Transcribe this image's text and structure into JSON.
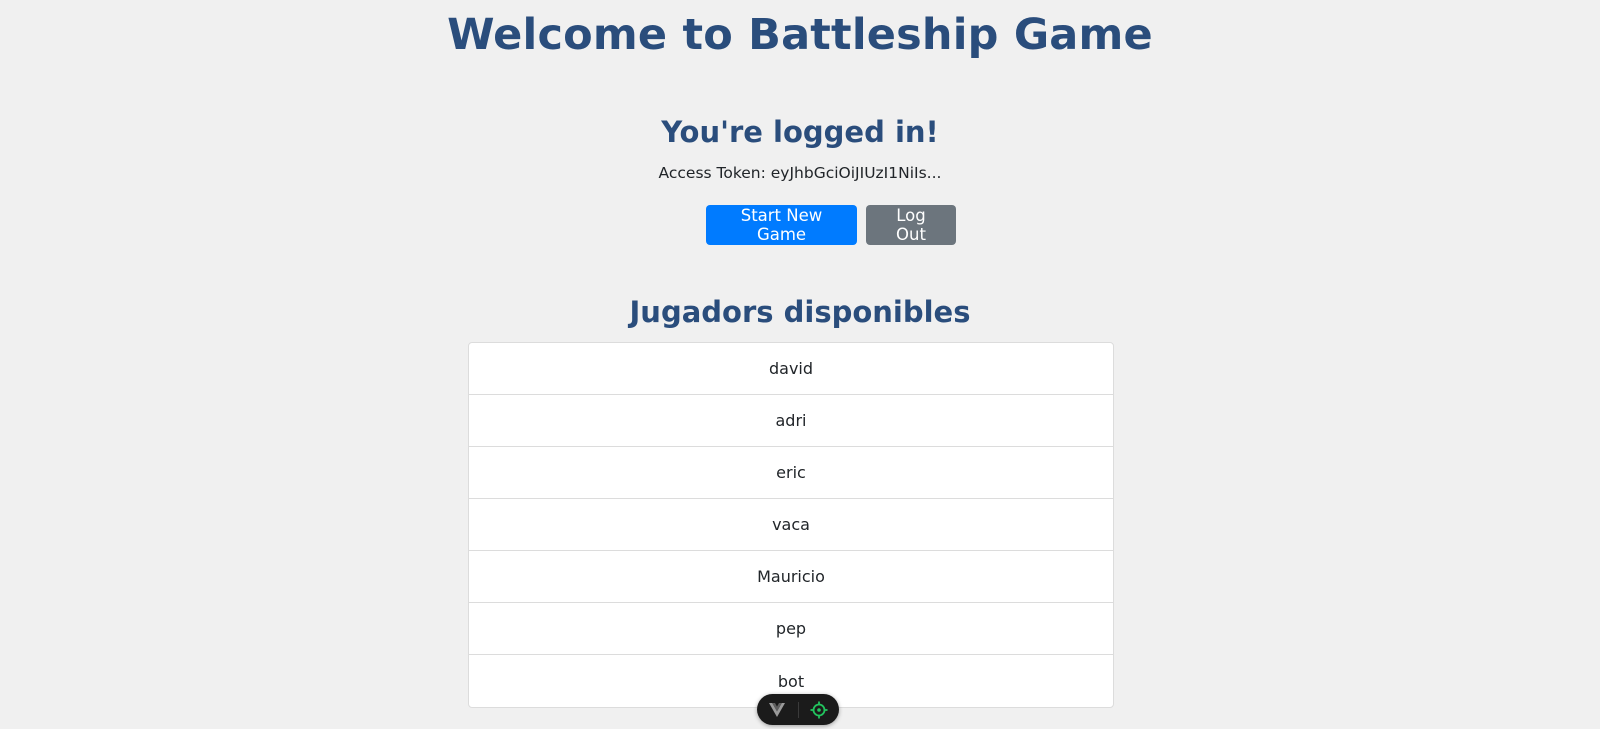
{
  "header": {
    "title": "Welcome to Battleship Game"
  },
  "session": {
    "status_title": "You're logged in!",
    "token_label": "Access Token: eyJhbGciOiJIUzI1NiIs..."
  },
  "actions": {
    "start_label": "Start New Game",
    "logout_label": "Log Out"
  },
  "players": {
    "title": "Jugadors disponibles",
    "items": [
      "david",
      "adri",
      "eric",
      "vaca",
      "Mauricio",
      "pep",
      "bot"
    ]
  },
  "devtools": {
    "left_icon": "vue-logo-icon",
    "right_icon": "target-inspect-icon"
  },
  "colors": {
    "background": "#f0f0f0",
    "heading": "#2a4d7c",
    "primary": "#007bff",
    "secondary": "#6c757d"
  }
}
